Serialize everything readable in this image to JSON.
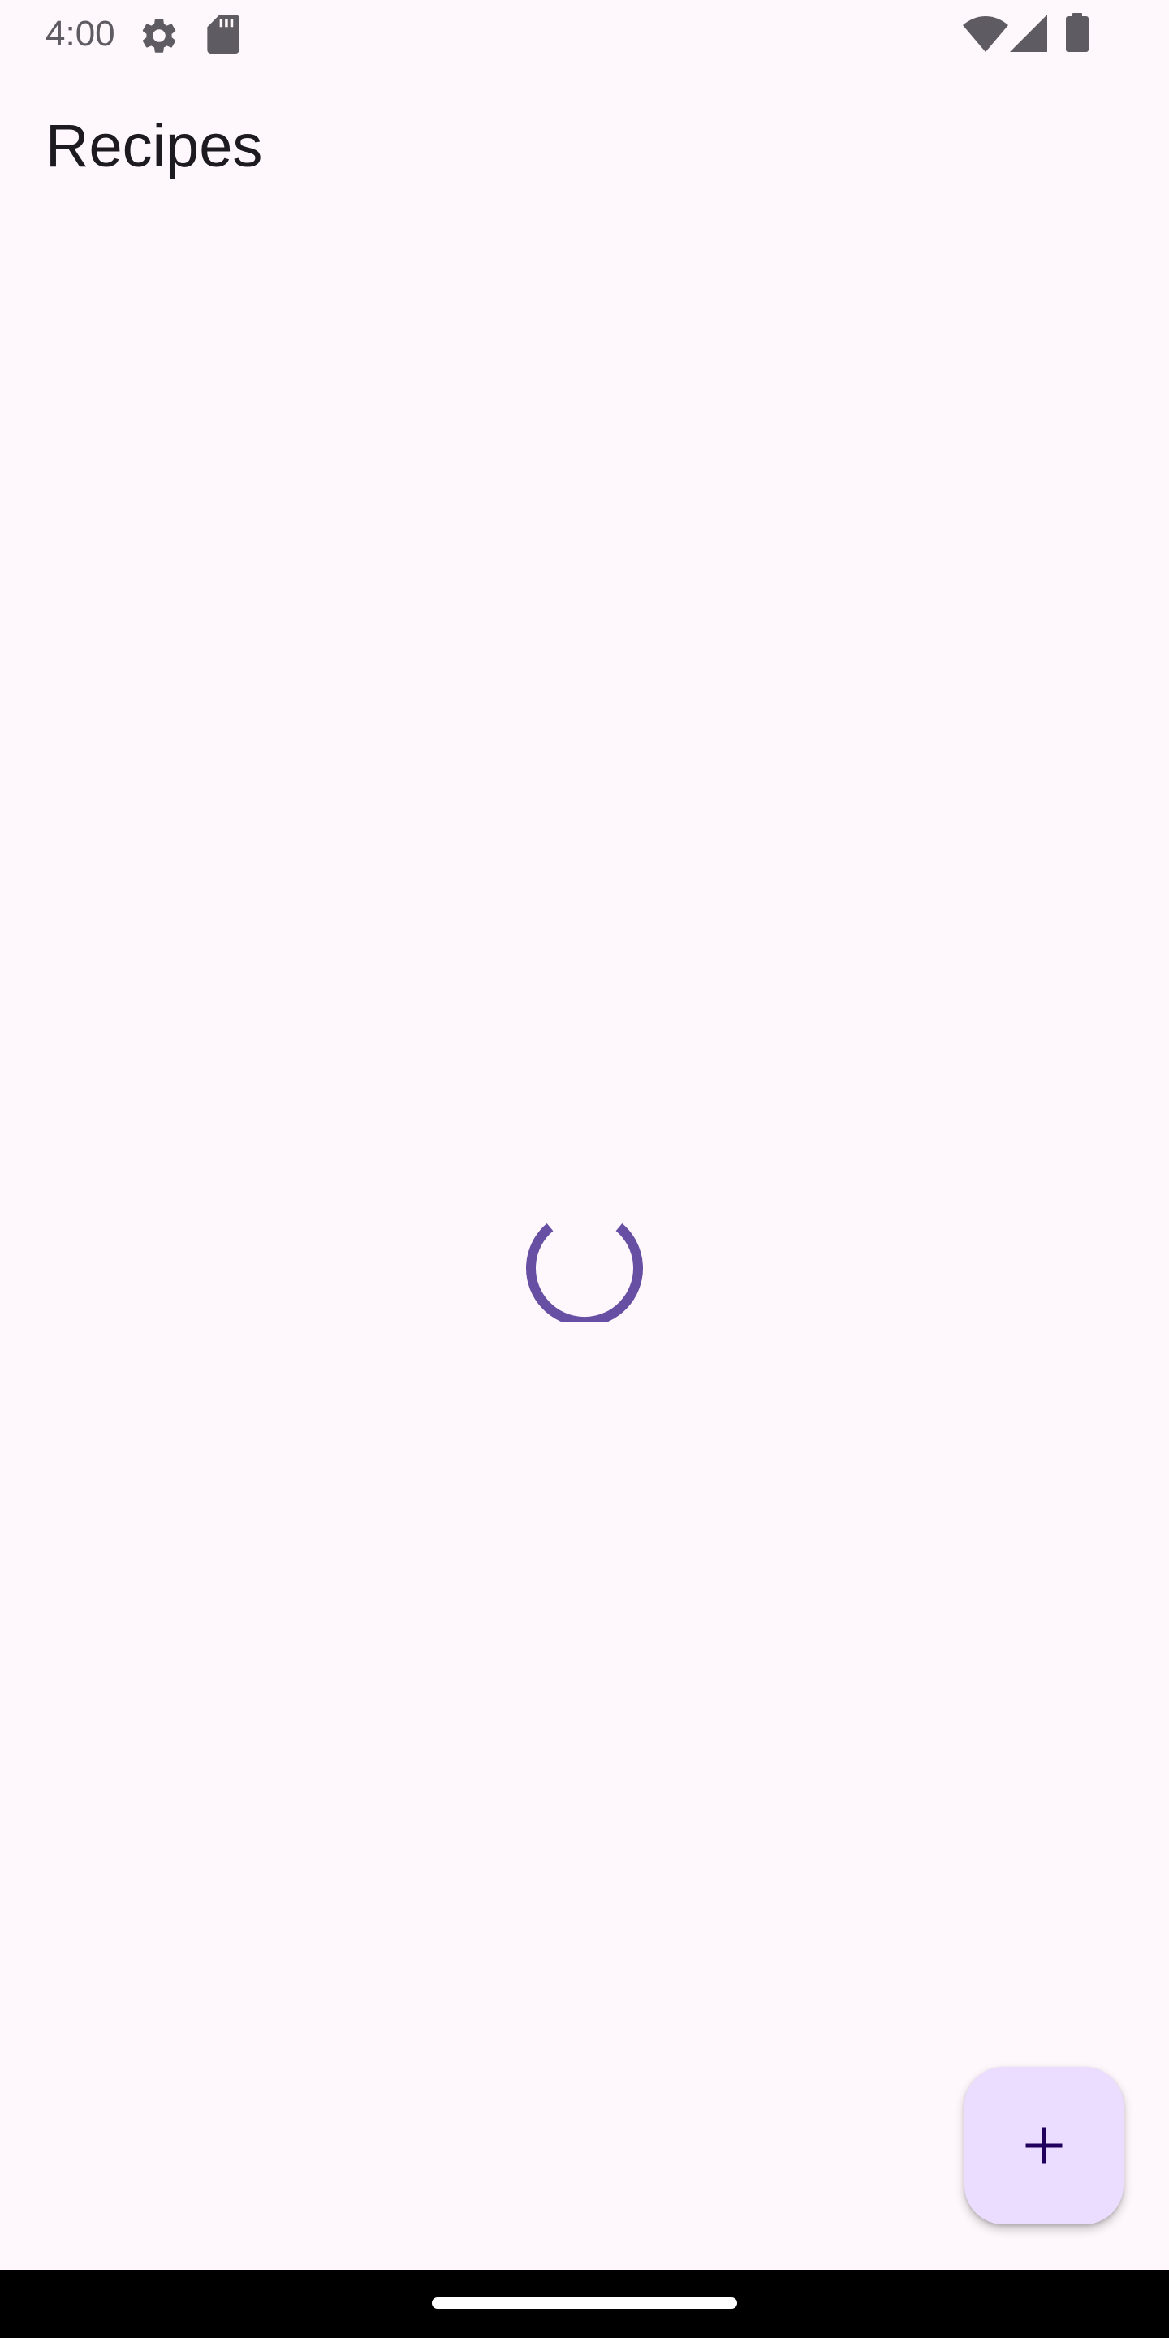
{
  "status_bar": {
    "time": "4:00",
    "icons": [
      "settings-icon",
      "sd-card-icon",
      "wifi-icon",
      "cellular-signal-icon",
      "battery-icon"
    ]
  },
  "app_bar": {
    "title": "Recipes"
  },
  "content": {
    "state": "loading",
    "spinner_color": "#6750a4"
  },
  "fab": {
    "icon": "add-icon",
    "background": "#eaddff",
    "icon_color": "#21005d"
  },
  "colors": {
    "background": "#fef7fb",
    "title_text": "#1d1b20",
    "status_text": "#5f5b62"
  }
}
